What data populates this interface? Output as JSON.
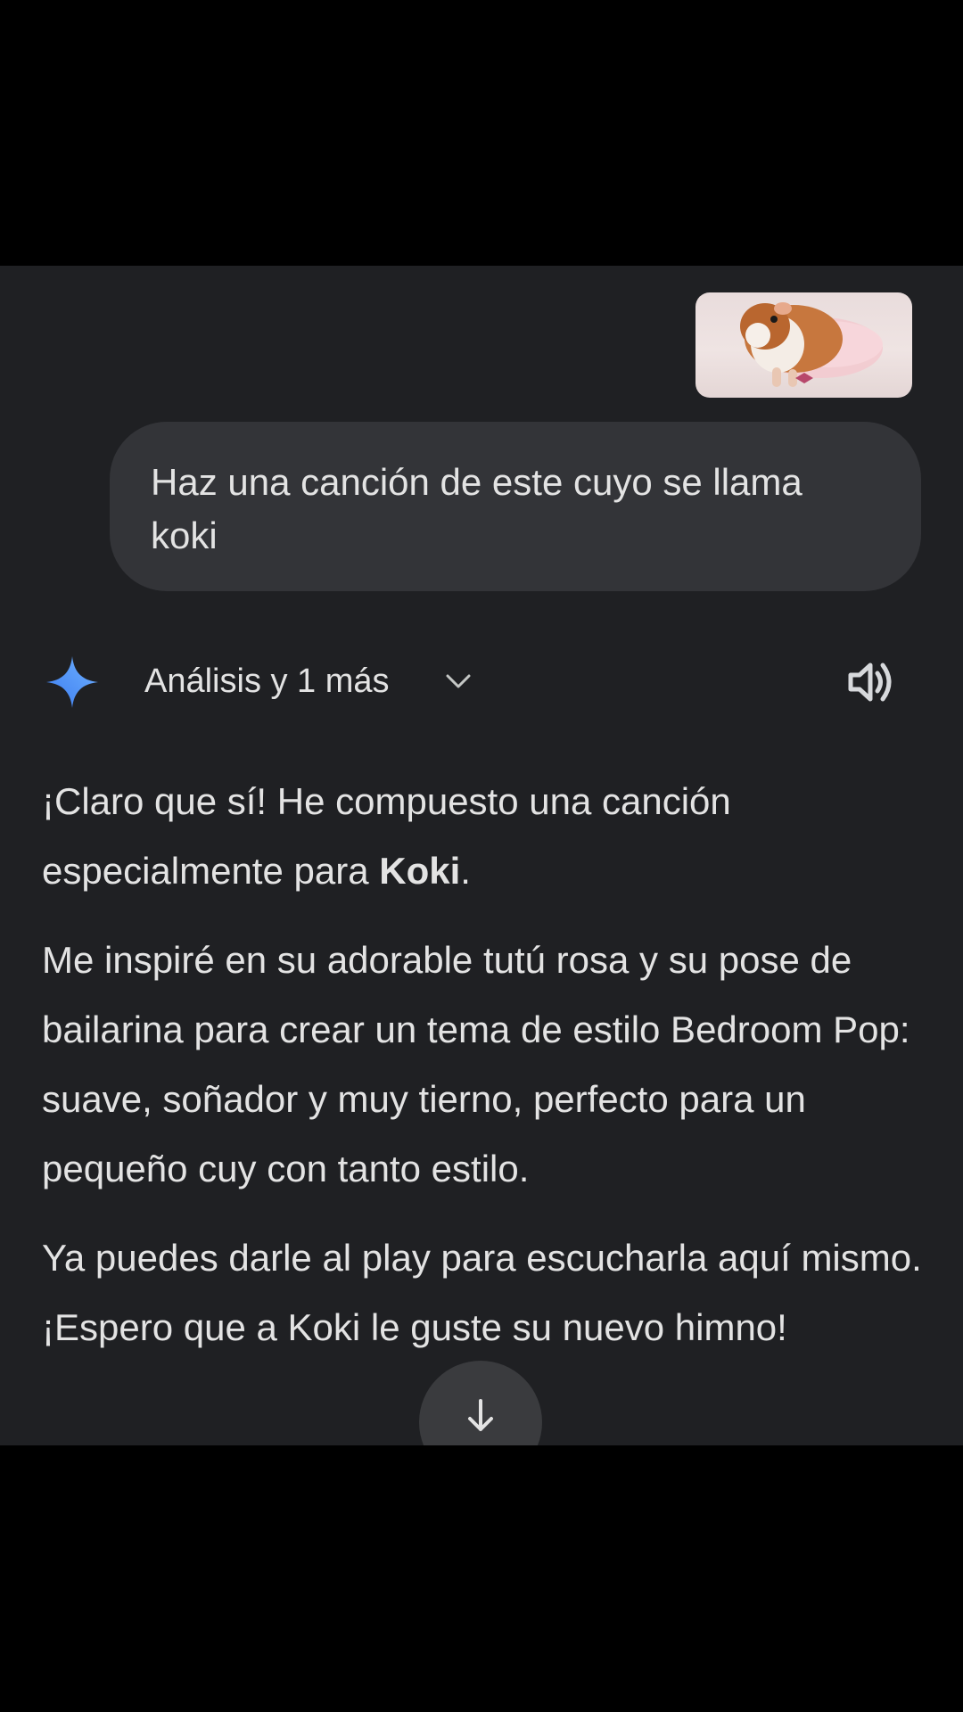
{
  "chat": {
    "attachment": {
      "description_icon": "guinea-pig-photo"
    },
    "user_message": "Haz una canción de este cuyo se llama koki",
    "response_header": {
      "label": "Análisis y 1 más",
      "icons": [
        "gemini-sparkle-icon",
        "chevron-down-icon",
        "speaker-icon"
      ]
    },
    "response": {
      "p1_before": "¡Claro que sí! He compuesto una canción especialmente para ",
      "p1_bold": "Koki",
      "p1_after": ".",
      "p2": "Me inspiré en su adorable tutú rosa y su pose de bailarina para crear un tema de estilo Bedroom Pop: suave, soñador y muy tierno, perfecto para un pequeño cuy con tanto estilo.",
      "p3": "Ya puedes darle al play para escucharla aquí mismo. ¡Espero que a Koki le guste su nuevo himno!"
    },
    "scroll_button_icon": "arrow-down-icon"
  },
  "colors": {
    "background": "#1f2023",
    "bubble": "#333438",
    "text": "#e3e3e3",
    "gemini_blue": "#4a90f5"
  }
}
